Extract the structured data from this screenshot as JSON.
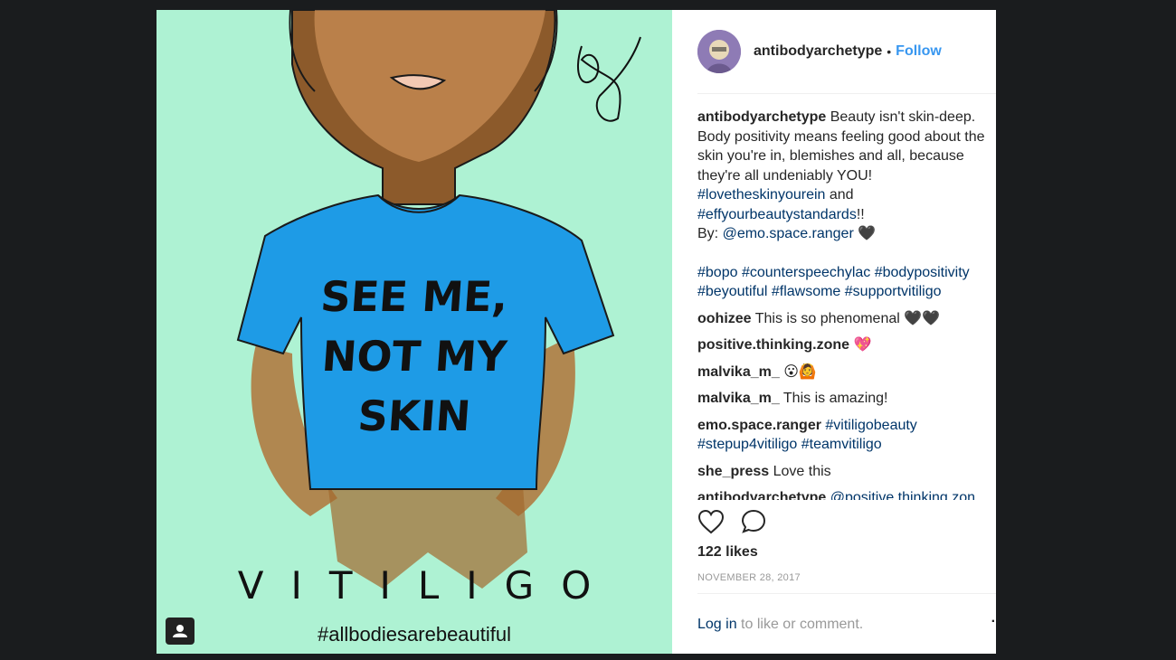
{
  "post": {
    "image": {
      "shirt_line1": "SEE ME,",
      "shirt_line2": "NOT MY",
      "shirt_line3": "SKIN",
      "title": "VITILIGO",
      "hashtag": "#allbodiesarebeautiful"
    },
    "header": {
      "username": "antibodyarchetype",
      "separator": "•",
      "follow_label": "Follow"
    },
    "caption": {
      "username": "antibodyarchetype",
      "text1": "Beauty isn't skin-deep. Body positivity means feeling good about the skin you're in, blemishes and all, because they're all undeniably YOU!",
      "tag1": "#lovetheskinyourein",
      "and": "and",
      "tag2": "#effyourbeautystandards",
      "after_tag2": "!!",
      "by": "By:",
      "mention": "@emo.space.ranger",
      "heart": "🖤",
      "tags_line1": [
        "#bopo",
        "#counterspeechylac",
        "#bodypositivity"
      ],
      "tags_line2": [
        "#beyoutiful",
        "#flawsome",
        "#supportvitiligo"
      ]
    },
    "comments": [
      {
        "user": "oohizee",
        "text": "This is so phenomenal 🖤🖤"
      },
      {
        "user": "positive.thinking.zone",
        "text": "💖"
      },
      {
        "user": "malvika_m_",
        "text": "😮🙆"
      },
      {
        "user": "malvika_m_",
        "text": "This is amazing!"
      },
      {
        "user": "emo.space.ranger",
        "tag1": "#vitiligobeauty",
        "tag2": "#stepup4vitiligo",
        "tag3": "#teamvitiligo"
      },
      {
        "user": "she_press",
        "text": "Love this"
      },
      {
        "user": "antibodyarchetype",
        "mention": "@positive.thinking.zon"
      }
    ],
    "likes": "122 likes",
    "date": "NOVEMBER 28, 2017",
    "login": {
      "link": "Log in",
      "rest": "to like or comment."
    },
    "colors": {
      "background": "#1a1c1e",
      "image_bg": "#aef2d3",
      "shirt": "#1e9be6",
      "skin": "#8c5a2b",
      "link": "#003569",
      "follow": "#3897f0"
    }
  }
}
